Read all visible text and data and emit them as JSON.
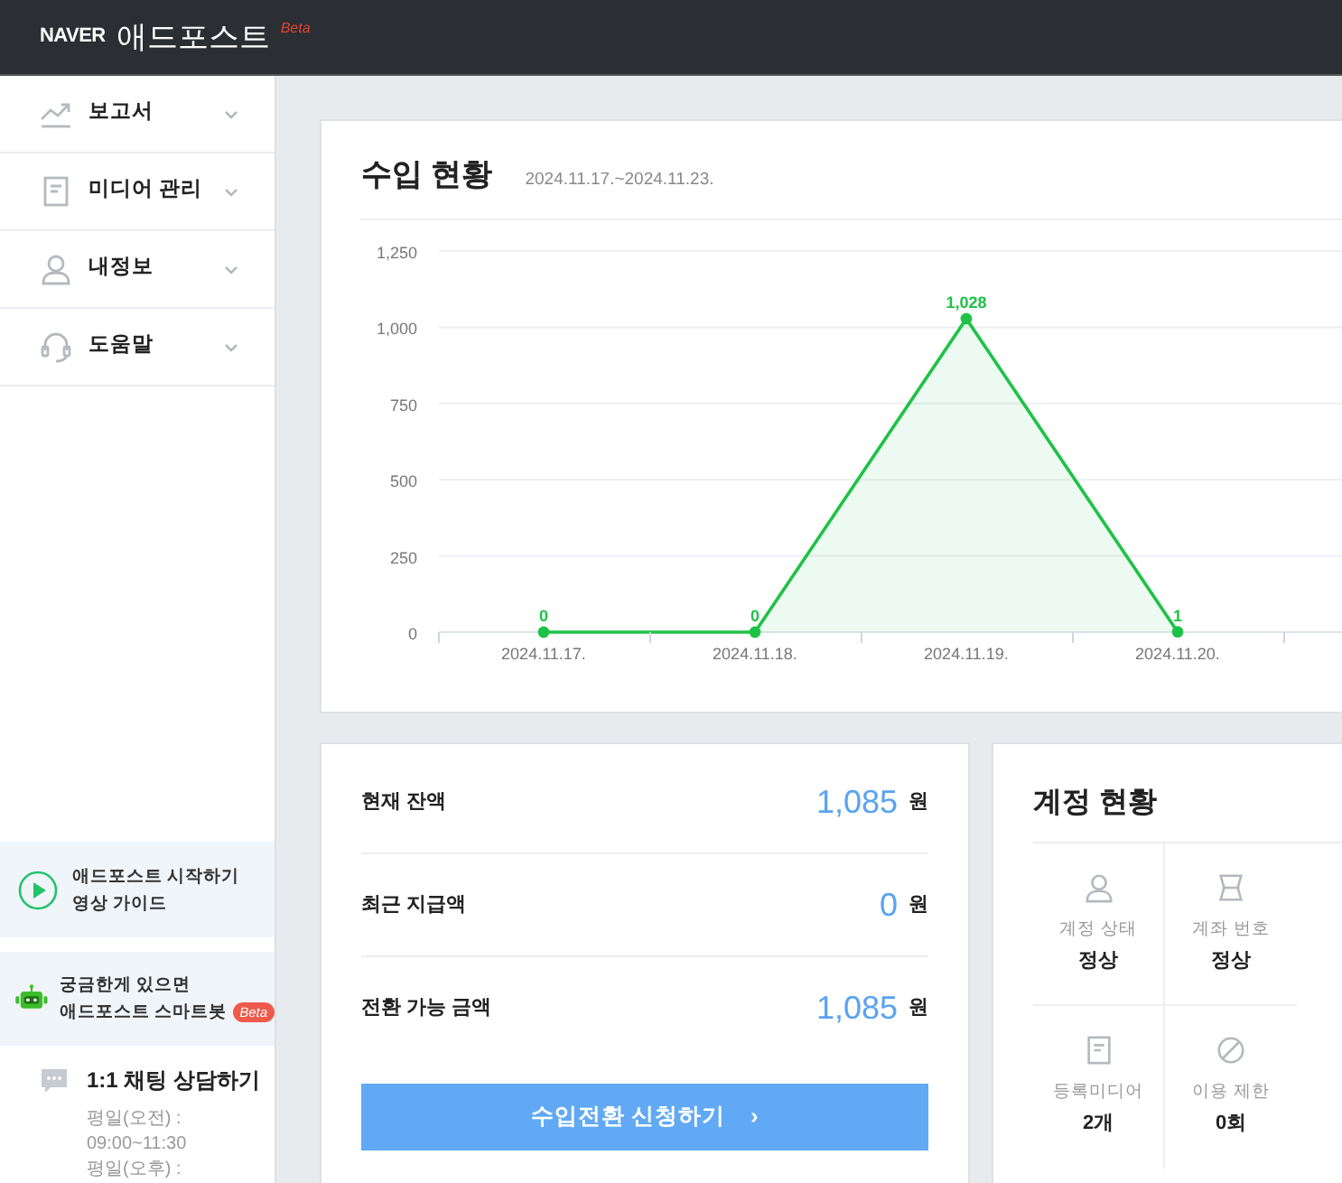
{
  "header": {
    "brand": "NAVER",
    "service": "애드포스트",
    "badge": "Beta"
  },
  "sidebar": {
    "items": [
      {
        "label": "보고서",
        "expanded": false
      },
      {
        "label": "미디어 관리",
        "expanded": false
      },
      {
        "label": "내정보",
        "expanded": false
      },
      {
        "label": "도움말",
        "expanded": false
      }
    ],
    "guide": {
      "lines": [
        "애드포스트 시작하기",
        "영상 가이드"
      ]
    },
    "chatbot": {
      "lines": [
        "궁금한게 있으면",
        "애드포스트 스마트봇"
      ],
      "badge": "Beta"
    },
    "chat": {
      "title": "1:1 채팅 상담하기",
      "hours": [
        "평일(오전) :",
        "09:00~11:30",
        "평일(오후) :"
      ]
    }
  },
  "income": {
    "title": "수입 현황",
    "period": "2024.11.17.~2024.11.23.",
    "chart_data": {
      "type": "area",
      "categories": [
        "2024.11.17.",
        "2024.11.18.",
        "2024.11.19.",
        "2024.11.20."
      ],
      "series": [
        {
          "color": "#1ec247",
          "values": [
            0,
            0,
            1028,
            1
          ]
        }
      ],
      "ylim": [
        0,
        1250
      ],
      "yticks": [
        0,
        {
          "value": 250,
          "label": "250"
        },
        {
          "value": 500,
          "label": "500"
        },
        {
          "value": 750,
          "label": "750"
        },
        {
          "value": 1000,
          "label": "1,000"
        },
        {
          "value": 1250,
          "label": "1,250"
        }
      ],
      "grid": true,
      "value_labels": [
        "0",
        "0",
        "1,028",
        "1"
      ]
    }
  },
  "balance": {
    "rows": [
      {
        "label": "현재 잔액",
        "amount": "1,085",
        "unit": "원"
      },
      {
        "label": "최근 지급액",
        "amount": "0",
        "unit": "원"
      },
      {
        "label": "전환 가능 금액",
        "amount": "1,085",
        "unit": "원"
      }
    ],
    "button": "수입전환 신청하기",
    "button_arrow": "›"
  },
  "account": {
    "title": "계정 현황",
    "cells": [
      {
        "label": "계정 상태",
        "value": "정상"
      },
      {
        "label": "계좌 번호",
        "value": "정상"
      },
      {
        "label": "등록미디어",
        "value": "2개"
      },
      {
        "label": "이용 제한",
        "value": "0회"
      }
    ]
  }
}
